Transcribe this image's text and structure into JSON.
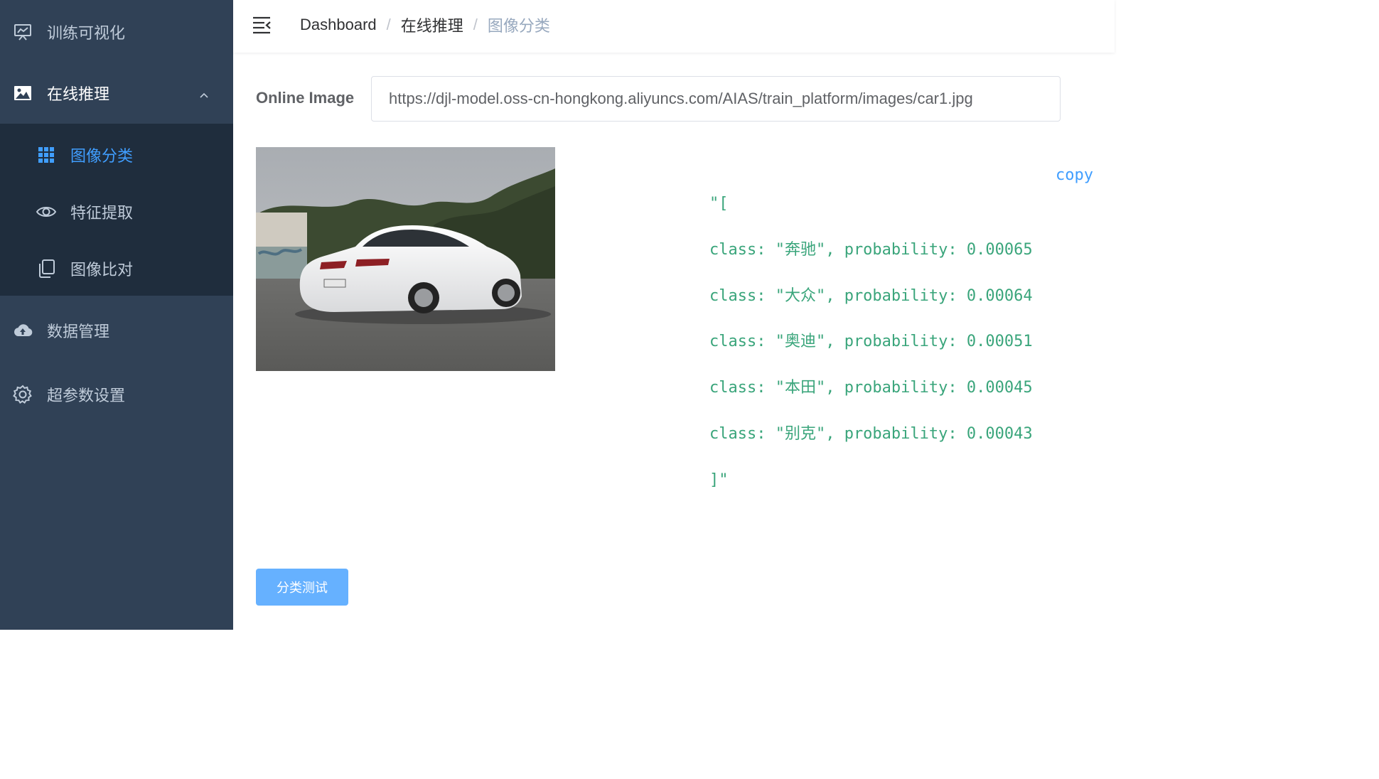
{
  "sidebar": {
    "items": [
      {
        "label": "训练可视化",
        "icon": "presentation-chart-icon"
      },
      {
        "label": "在线推理",
        "icon": "picture-icon",
        "expanded": true
      },
      {
        "label": "数据管理",
        "icon": "cloud-upload-icon"
      },
      {
        "label": "超参数设置",
        "icon": "gear-icon"
      }
    ],
    "submenu": [
      {
        "label": "图像分类",
        "icon": "grid-icon",
        "active": true
      },
      {
        "label": "特征提取",
        "icon": "eye-icon"
      },
      {
        "label": "图像比对",
        "icon": "copy-icon"
      }
    ]
  },
  "header": {
    "breadcrumb": [
      "Dashboard",
      "在线推理",
      "图像分类"
    ]
  },
  "form": {
    "image_label": "Online Image",
    "image_url": "https://djl-model.oss-cn-hongkong.aliyuncs.com/AIAS/train_platform/images/car1.jpg"
  },
  "result": {
    "copy_label": "copy",
    "open": "\"[",
    "lines": [
      "class: \"奔驰\", probability: 0.00065",
      "class: \"大众\", probability: 0.00064",
      "class: \"奥迪\", probability: 0.00051",
      "class: \"本田\", probability: 0.00045",
      "class: \"别克\", probability: 0.00043"
    ],
    "close": "]\""
  },
  "actions": {
    "classify_button": "分类测试"
  },
  "colors": {
    "sidebar_bg": "#304156",
    "submenu_bg": "#1f2d3d",
    "accent": "#409eff",
    "result_text": "#3aa57b"
  }
}
